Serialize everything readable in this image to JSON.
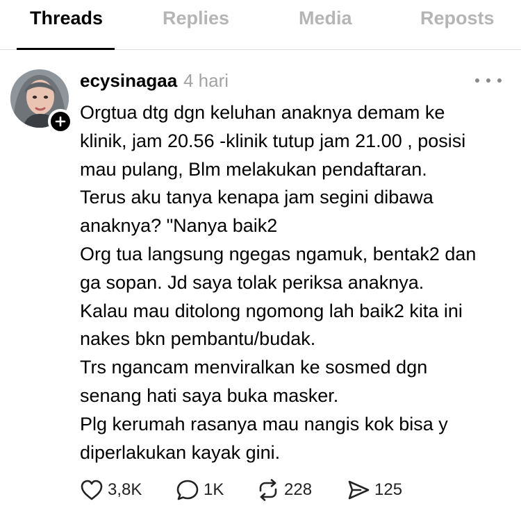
{
  "tabs": [
    {
      "label": "Threads",
      "active": true
    },
    {
      "label": "Replies",
      "active": false
    },
    {
      "label": "Media",
      "active": false
    },
    {
      "label": "Reposts",
      "active": false
    }
  ],
  "post": {
    "username": "ecysinagaa",
    "time": "4 hari",
    "text_lines": [
      "Orgtua dtg dgn keluhan anaknya demam ke",
      "klinik, jam 20.56 -klinik tutup jam 21.00 , posisi",
      "mau pulang, Blm melakukan pendaftaran.",
      "Terus aku tanya kenapa jam segini dibawa",
      "anaknya? \"Nanya baik2",
      "Org tua langsung ngegas ngamuk, bentak2 dan",
      "ga sopan. Jd saya tolak periksa anaknya.",
      "Kalau mau ditolong ngomong lah baik2 kita ini",
      "nakes bkn pembantu/budak.",
      "Trs ngancam menviralkan ke sosmed dgn",
      "senang hati saya buka masker.",
      "Plg kerumah rasanya mau nangis kok bisa y",
      "diperlakukan kayak gini."
    ],
    "actions": {
      "likes": "3,8K",
      "replies": "1K",
      "reposts": "228",
      "shares": "125"
    }
  },
  "icons": {
    "like": "heart-icon",
    "reply": "speech-bubble-icon",
    "repost": "repost-arrows-icon",
    "share": "send-icon",
    "more": "more-horizontal-icon",
    "follow": "plus-icon"
  }
}
